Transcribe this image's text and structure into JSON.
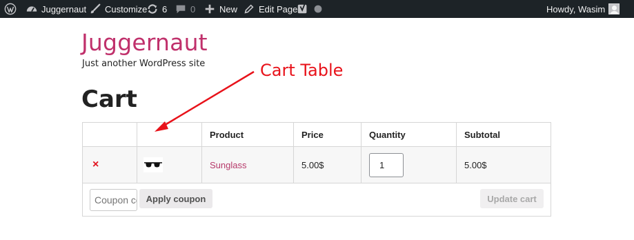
{
  "admin_bar": {
    "site_name": "Juggernaut",
    "customize_label": "Customize",
    "updates_count": "6",
    "comments_count": "0",
    "new_label": "New",
    "edit_page_label": "Edit Page",
    "greeting": "Howdy, Wasim",
    "icons": [
      "wordpress-logo-icon",
      "dashboard-icon",
      "brush-icon",
      "updates-icon",
      "comment-icon",
      "plus-icon",
      "pencil-icon",
      "yoast-icon",
      "status-dot-icon",
      "user-avatar"
    ]
  },
  "site": {
    "title": "Juggernaut",
    "description": "Just another WordPress site",
    "title_color": "#c0306b"
  },
  "page": {
    "title": "Cart"
  },
  "annotation": {
    "label": "Cart Table",
    "color": "#e8121a"
  },
  "cart": {
    "columns": [
      "",
      "",
      "Product",
      "Price",
      "Quantity",
      "Subtotal"
    ],
    "items": [
      {
        "remove_symbol": "×",
        "thumbnail": "sunglasses-icon",
        "product": "Sunglass",
        "price": "5.00$",
        "quantity": "1",
        "subtotal": "5.00$"
      }
    ],
    "coupon_placeholder": "Coupon code",
    "apply_coupon_label": "Apply coupon",
    "update_cart_label": "Update cart"
  }
}
